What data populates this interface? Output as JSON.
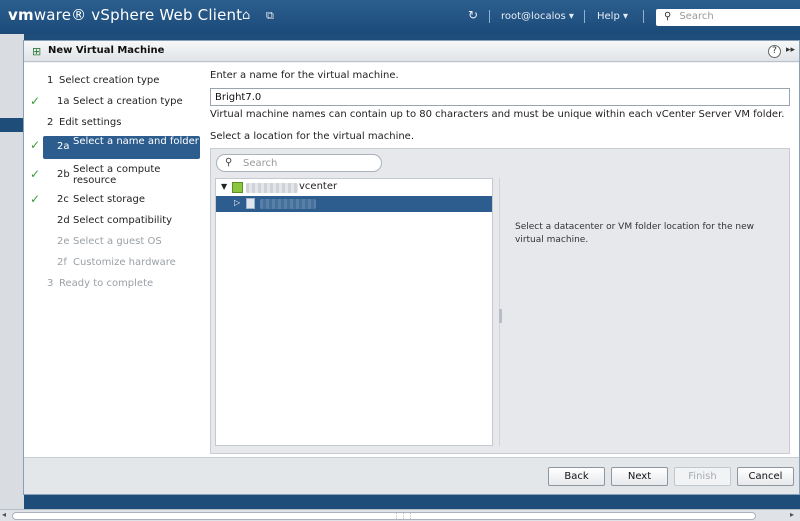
{
  "header": {
    "brand_vm": "vm",
    "brand_rest": "ware® vSphere Web Client",
    "user": "root@localos ▾",
    "help": "Help ▾",
    "search_placeholder": "Search"
  },
  "dialog": {
    "title": "New Virtual Machine",
    "help_glyph": "?",
    "more_glyph": "▸▸"
  },
  "steps": [
    {
      "num": "1",
      "label": "Select creation type",
      "state": "normal"
    },
    {
      "num": "1a",
      "label": "Select a creation type",
      "state": "done"
    },
    {
      "num": "2",
      "label": "Edit settings",
      "state": "normal"
    },
    {
      "num": "2a",
      "label": "Select a name and folder",
      "state": "active"
    },
    {
      "num": "2b",
      "label": "Select a compute resource",
      "state": "done"
    },
    {
      "num": "2c",
      "label": "Select storage",
      "state": "done"
    },
    {
      "num": "2d",
      "label": "Select compatibility",
      "state": "normal"
    },
    {
      "num": "2e",
      "label": "Select a guest OS",
      "state": "disabled"
    },
    {
      "num": "2f",
      "label": "Customize hardware",
      "state": "disabled"
    },
    {
      "num": "3",
      "label": "Ready to complete",
      "state": "disabled"
    }
  ],
  "content": {
    "name_prompt": "Enter a name for the virtual machine.",
    "name_value": "Bright7.0",
    "name_hint": "Virtual machine names can contain up to 80 characters and must be unique within each vCenter Server VM folder.",
    "location_prompt": "Select a location for the virtual machine.",
    "location_search_placeholder": "Search",
    "tree_root_suffix": "vcenter",
    "location_hint": "Select a datacenter or VM folder location for the new virtual machine."
  },
  "buttons": {
    "back": "Back",
    "next": "Next",
    "finish": "Finish",
    "cancel": "Cancel"
  }
}
